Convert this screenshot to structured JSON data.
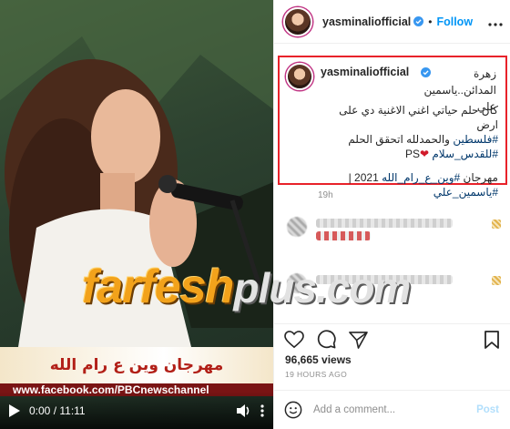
{
  "video": {
    "banner_text": "مهرجان وين ع رام الله",
    "url_text": "www.facebook.com/PBCnewschannel",
    "time": "0:00 / 11:11",
    "icons": {
      "play": "play-icon",
      "volume": "volume-icon",
      "more": "more-vertical-icon"
    }
  },
  "watermark": {
    "main": "farfesh",
    "suffix": "plus.com"
  },
  "header": {
    "username": "yasminaliofficial",
    "separator": "•",
    "follow_label": "Follow"
  },
  "caption": {
    "username": "yasminaliofficial",
    "title_line": "زهرة المدائن..ياسمين علي",
    "line1": "كان حلم حياتي اغني الاغنية دي على ارض",
    "hashtag_palestine": "#فلسطين",
    "line2_text": " والحمدلله اتحقق الحلم",
    "hashtag_quds": "#للقدس_سلام",
    "ps": "PS",
    "line3_prefix": "مهرجان ",
    "hashtag_festival": "#وين_ع_رام_الله",
    "line3_suffix": " 2021 |",
    "hashtag_name": "#ياسمين_علي"
  },
  "posted_ago": "19h",
  "stats": {
    "views": "96,665 views",
    "time_ago": "19 HOURS AGO"
  },
  "comment_bar": {
    "placeholder": "Add a comment...",
    "post_label": "Post"
  },
  "colors": {
    "accent_blue": "#0095f6",
    "highlight_border": "#e8222a",
    "hashtag": "#00376b",
    "meta_gray": "#8e8e8e"
  }
}
